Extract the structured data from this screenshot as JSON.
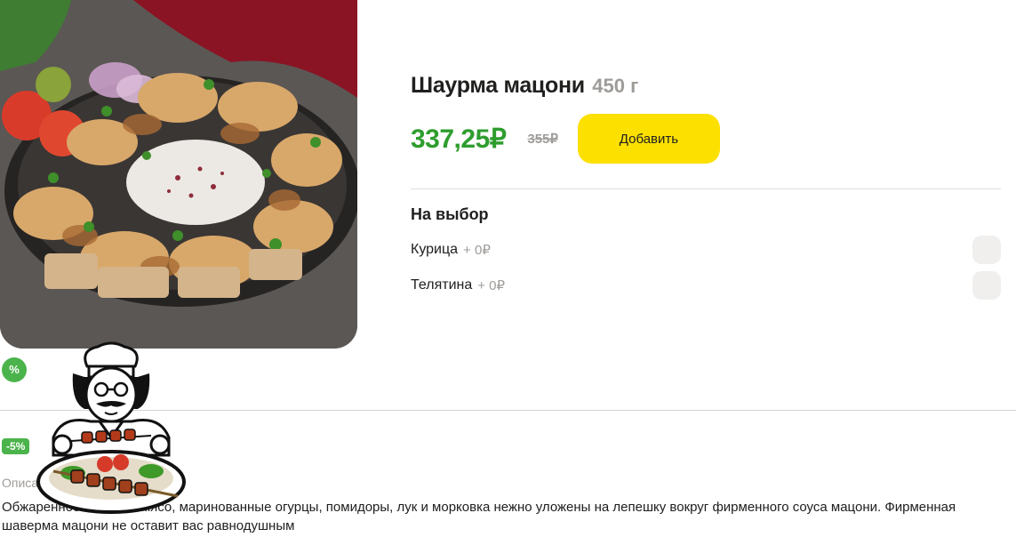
{
  "product": {
    "title": "Шаурма мацони",
    "weight": "450 г",
    "price_new": "337,25₽",
    "price_old": "355₽",
    "add_button": "Добавить",
    "discount_icon": "%",
    "discount_badge": "-5%"
  },
  "options": {
    "title": "На выбор",
    "items": [
      {
        "label": "Курица",
        "price": "+ 0₽"
      },
      {
        "label": "Телятина",
        "price": "+ 0₽"
      }
    ]
  },
  "description": {
    "title": "Описание",
    "text": "Обжаренное на гриле мясо, маринованные огурцы, помидоры, лук и морковка нежно уложены на лепешку вокруг фирменного соуса мацони. Фирменная шаверма мацони не оставит вас равнодушным"
  },
  "icons": {
    "chef": "chef-with-kebab-icon",
    "checkbox": "checkbox-icon"
  },
  "colors": {
    "accent_yellow": "#fce000",
    "price_green": "#2e9d2e",
    "badge_green": "#4bb34b"
  }
}
